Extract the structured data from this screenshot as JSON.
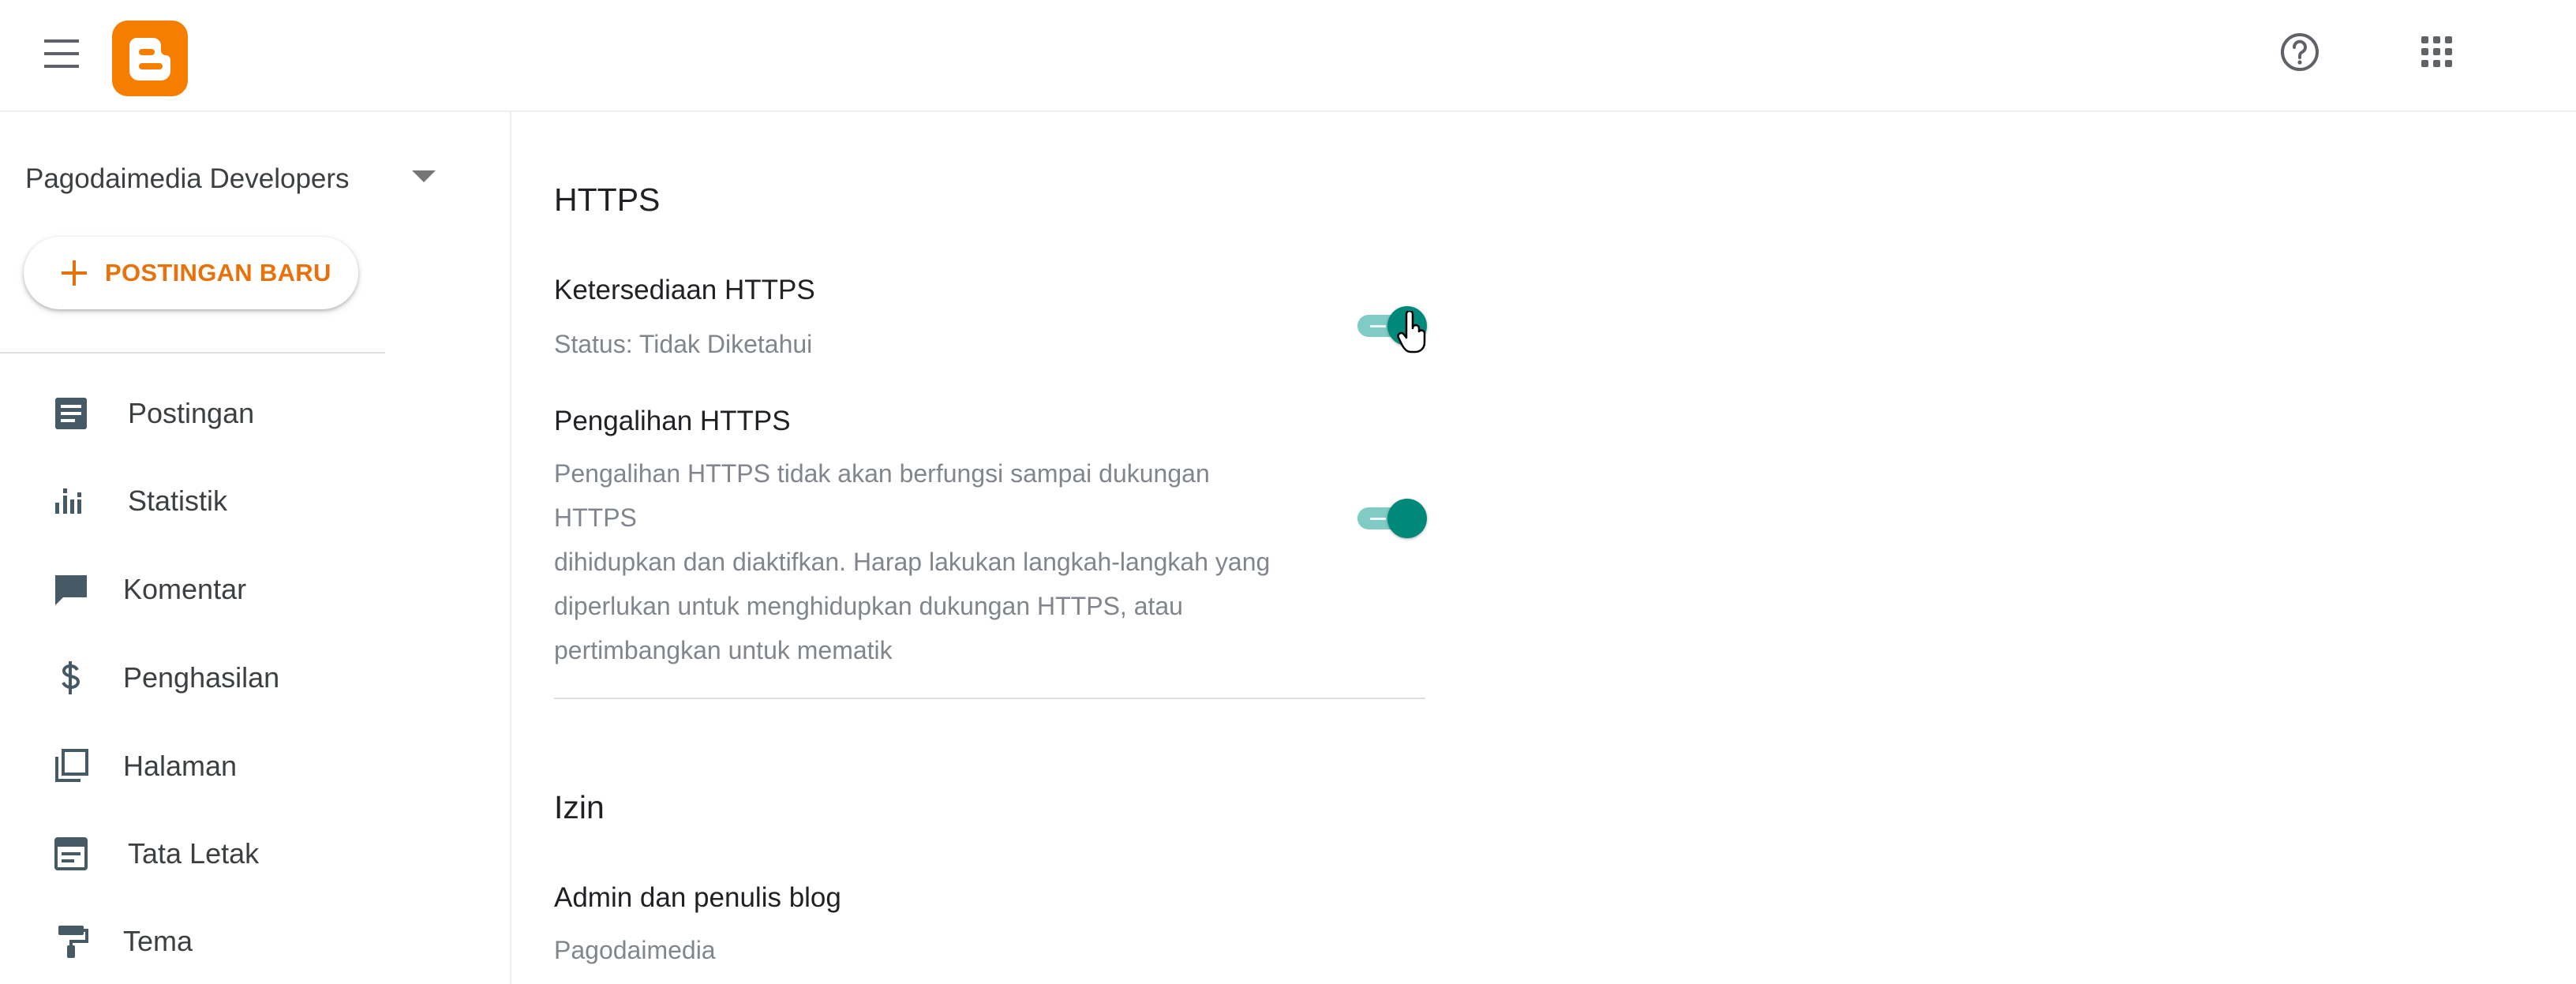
{
  "header": {
    "menu_icon": "hamburger-menu-icon",
    "logo_icon": "blogger-logo-icon",
    "help_icon": "help-circle-icon",
    "apps_icon": "apps-grid-icon",
    "logo_color": "#f57d00"
  },
  "sidebar": {
    "blog_name": "Pagodaimedia Developers",
    "new_post_label": "POSTINGAN BARU",
    "accent_color": "#e8710a",
    "items": [
      {
        "label": "Postingan",
        "icon": "posts-icon"
      },
      {
        "label": "Statistik",
        "icon": "stats-icon"
      },
      {
        "label": "Komentar",
        "icon": "comment-icon"
      },
      {
        "label": "Penghasilan",
        "icon": "dollar-icon"
      },
      {
        "label": "Halaman",
        "icon": "pages-icon"
      },
      {
        "label": "Tata Letak",
        "icon": "layout-icon"
      },
      {
        "label": "Tema",
        "icon": "paint-roller-icon"
      }
    ]
  },
  "main": {
    "https_section": {
      "title": "HTTPS",
      "availability": {
        "title": "Ketersediaan HTTPS",
        "status": "Status: Tidak Diketahui",
        "enabled": true
      },
      "redirect": {
        "title": "Pengalihan HTTPS",
        "description_lines": [
          "Pengalihan HTTPS tidak akan berfungsi sampai dukungan HTTPS",
          "dihidupkan dan diaktifkan. Harap lakukan langkah-langkah yang",
          "diperlukan untuk menghidupkan dukungan HTTPS, atau",
          "pertimbangkan untuk mematik"
        ],
        "enabled": true
      },
      "toggle_color": "#00897b"
    },
    "permissions_section": {
      "title": "Izin",
      "admins_title": "Admin dan penulis blog",
      "admins_value": "Pagodaimedia"
    }
  }
}
